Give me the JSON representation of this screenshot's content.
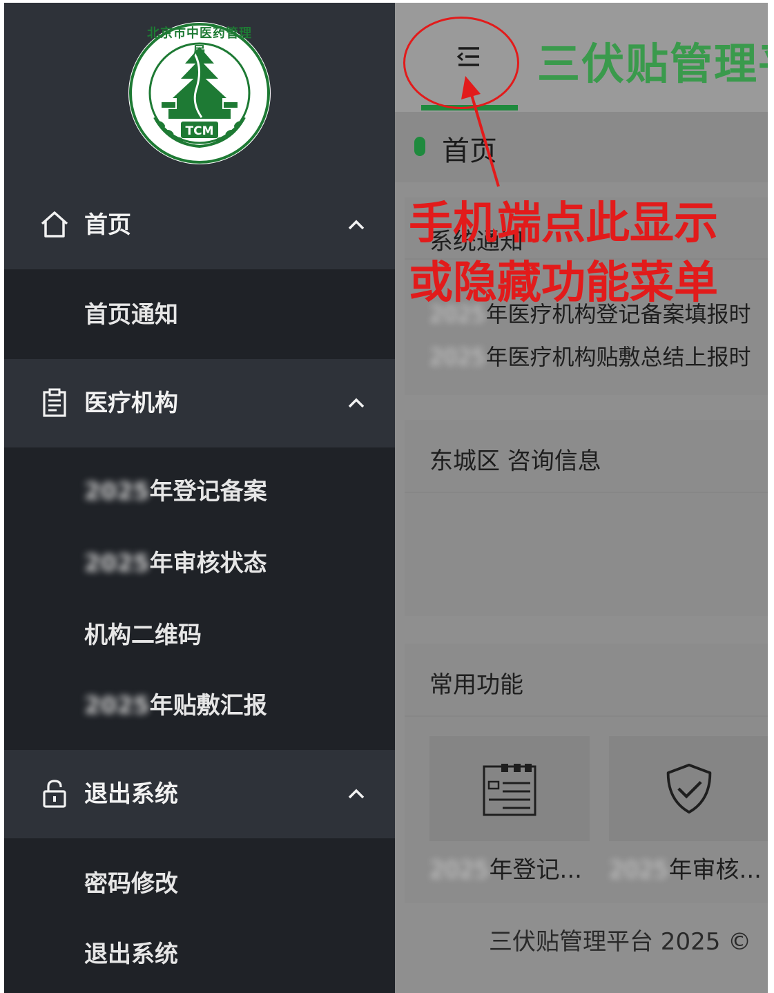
{
  "sidebar": {
    "logo": {
      "text_arc": "北京市中医药管理局",
      "text_badge": "TCM",
      "icon": "tcm-logo-icon"
    },
    "groups": [
      {
        "label": "首页",
        "icon": "home-icon",
        "items": [
          "首页通知"
        ]
      },
      {
        "label": "医疗机构",
        "icon": "clipboard-icon",
        "items": [
          "2025年登记备案",
          "2025年审核状态",
          "机构二维码",
          "2025年贴敷汇报"
        ]
      },
      {
        "label": "退出系统",
        "icon": "lock-icon",
        "items": [
          "密码修改",
          "退出系统"
        ]
      }
    ]
  },
  "header": {
    "title": "三伏贴管理平",
    "menu_toggle_icon": "menu-fold-icon"
  },
  "tags": {
    "current": "首页"
  },
  "notice_card": {
    "title": "系统通知",
    "items": [
      "2025年医疗机构登记备案填报时",
      "2025年医疗机构贴敷总结上报时"
    ]
  },
  "consult_card": {
    "title": "东城区 咨询信息"
  },
  "functions_card": {
    "title": "常用功能",
    "tiles": [
      {
        "label": "2025年登记...",
        "icon": "calendar-list-icon"
      },
      {
        "label": "2025年审核...",
        "icon": "shield-check-icon"
      }
    ]
  },
  "footer": {
    "text": "三伏贴管理平台 2025 ©"
  },
  "annotation": {
    "line1": "手机端点此显示",
    "line2": "或隐藏功能菜单"
  },
  "colors": {
    "sidebar_bg": "#1f2227",
    "group_bg": "#2e3239",
    "brand_green": "#1f8a3e",
    "title_green": "#3a9a4c",
    "annotation_red": "#e21b1b"
  }
}
